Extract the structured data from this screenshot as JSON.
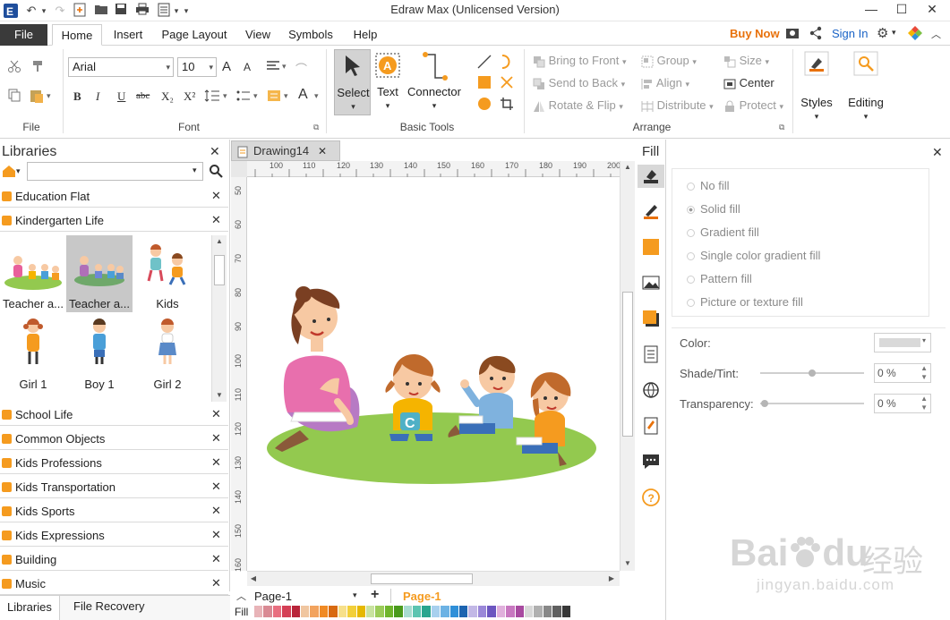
{
  "app": {
    "title": "Edraw Max (Unlicensed Version)",
    "buy_now": "Buy Now",
    "sign_in": "Sign In"
  },
  "menu": {
    "file": "File",
    "tabs": [
      "Home",
      "Insert",
      "Page Layout",
      "View",
      "Symbols",
      "Help"
    ]
  },
  "ribbon": {
    "file_group": {
      "label": "File"
    },
    "font_group": {
      "label": "Font",
      "font_name": "Arial",
      "font_size": "10",
      "bold": "B",
      "italic": "I",
      "underline": "U",
      "strike": "abc",
      "subscript": "X₂",
      "superscript": "X²",
      "grow": "A",
      "shrink": "A"
    },
    "basic_tools": {
      "label": "Basic Tools",
      "select": "Select",
      "text": "Text",
      "connector": "Connector"
    },
    "arrange": {
      "label": "Arrange",
      "bring_to_front": "Bring to Front",
      "send_to_back": "Send to Back",
      "rotate_flip": "Rotate & Flip",
      "group": "Group",
      "align": "Align",
      "distribute": "Distribute",
      "size": "Size",
      "center": "Center",
      "protect": "Protect"
    },
    "styles": "Styles",
    "editing": "Editing"
  },
  "libraries": {
    "title": "Libraries",
    "search_value": "",
    "categories_top": [
      "Education Flat",
      "Kindergarten Life"
    ],
    "shapes": [
      {
        "caption": "Teacher a..."
      },
      {
        "caption": "Teacher a..."
      },
      {
        "caption": "Kids"
      },
      {
        "caption": "Girl 1"
      },
      {
        "caption": "Boy 1"
      },
      {
        "caption": "Girl 2"
      }
    ],
    "categories_bottom": [
      "School Life",
      "Common Objects",
      "Kids Professions",
      "Kids Transportation",
      "Kids Sports",
      "Kids Expressions",
      "Building",
      "Music"
    ]
  },
  "bottom_tabs": {
    "libraries": "Libraries",
    "file_recovery": "File Recovery"
  },
  "document": {
    "tab_name": "Drawing14",
    "page_select": "Page-1",
    "page_tab": "Page-1",
    "fill_label": "Fill",
    "h_ruler": [
      "100",
      "110",
      "120",
      "130",
      "140",
      "150",
      "160",
      "170",
      "180",
      "190",
      "200"
    ],
    "v_ruler": [
      "50",
      "60",
      "70",
      "80",
      "90",
      "100",
      "110",
      "120",
      "130",
      "140",
      "150",
      "160"
    ]
  },
  "fill_panel": {
    "title": "Fill",
    "options": [
      "No fill",
      "Solid fill",
      "Gradient fill",
      "Single color gradient fill",
      "Pattern fill",
      "Picture or texture fill"
    ],
    "selected": "Solid fill",
    "color_label": "Color:",
    "shade_label": "Shade/Tint:",
    "shade_value": "0 %",
    "transparency_label": "Transparency:",
    "transparency_value": "0 %"
  },
  "watermark": {
    "brand": "Bai",
    "brand2": "du",
    "site_cn": "经验",
    "url": "jingyan.baidu.com"
  },
  "colors": {
    "accent_orange": "#f59b1f",
    "file_tab": "#3a3a3a",
    "buy_now": "#e8710a",
    "sign_in": "#1a63c6",
    "grass": "#93c94f"
  }
}
